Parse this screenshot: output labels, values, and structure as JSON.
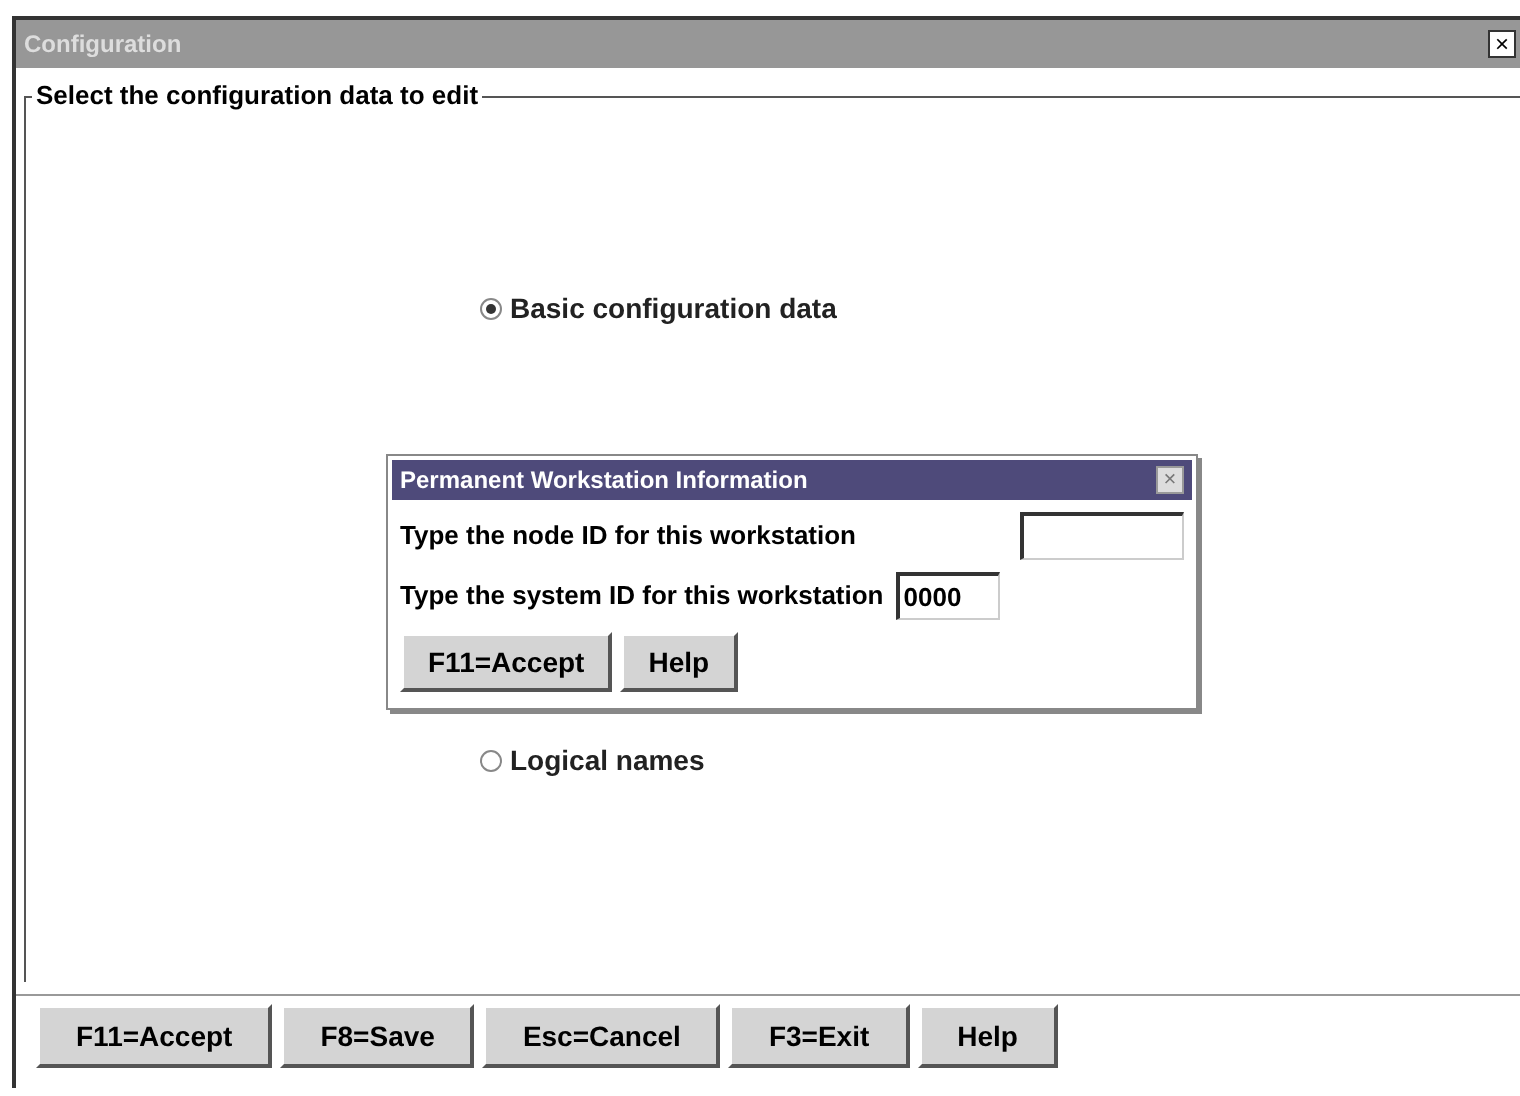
{
  "window": {
    "title": "Configuration",
    "close": "×"
  },
  "group": {
    "label": "Select the configuration data to edit"
  },
  "options": [
    {
      "label": "Basic configuration data",
      "selected": true
    },
    {
      "label": "Logical names",
      "selected": false
    }
  ],
  "dialog": {
    "title": "Permanent Workstation Information",
    "close": "×",
    "fields": [
      {
        "label": "Type the node ID for this workstation"
      },
      {
        "label": "Type the system ID for this workstation",
        "value": "0000"
      }
    ],
    "buttons": [
      "F11=Accept",
      "Help"
    ]
  },
  "buttons": [
    "F11=Accept",
    "F8=Save",
    "Esc=Cancel",
    "F3=Exit",
    "Help"
  ]
}
